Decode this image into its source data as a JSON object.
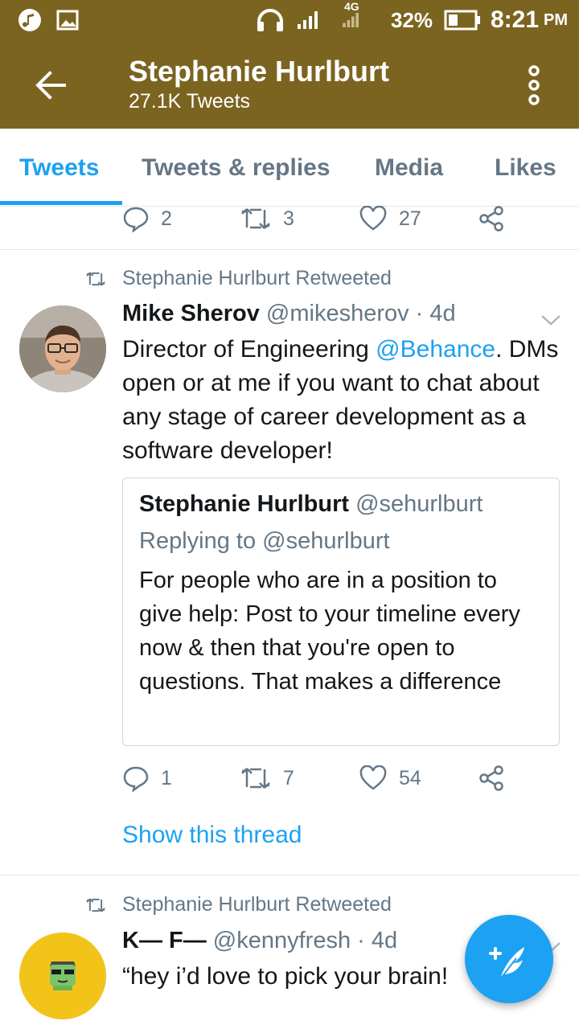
{
  "status_bar": {
    "icons": [
      "music-note-icon",
      "image-icon",
      "headphones-icon",
      "signal-icon",
      "4g-signal-icon",
      "battery-icon"
    ],
    "network": "4G",
    "battery": "32%",
    "time": "8:21",
    "ampm": "PM"
  },
  "header": {
    "title": "Stephanie Hurlburt",
    "subtitle": "27.1K Tweets"
  },
  "tabs": [
    {
      "label": "Tweets",
      "active": true
    },
    {
      "label": "Tweets & replies",
      "active": false
    },
    {
      "label": "Media",
      "active": false
    },
    {
      "label": "Likes",
      "active": false
    }
  ],
  "top_actions": {
    "replies": "2",
    "retweets": "3",
    "likes": "27"
  },
  "tweet1": {
    "retweeted_by": "Stephanie Hurlburt Retweeted",
    "name": "Mike Sherov",
    "handle": "@mikesherov · 4d",
    "text_before": "Director of Engineering ",
    "mention": "@Behance",
    "text_after": ". DMs open or at me if you want to chat about any stage of career development as a software developer!",
    "quote": {
      "name": "Stephanie Hurlburt",
      "handle": "@sehurlburt",
      "replying_to": "Replying to @sehurlburt",
      "text": "For people who are in a position to give help: Post to your timeline every now & then that you're open to questions. That makes a difference"
    },
    "actions": {
      "replies": "1",
      "retweets": "7",
      "likes": "54"
    },
    "show_thread": "Show this thread"
  },
  "tweet2": {
    "retweeted_by": "Stephanie Hurlburt Retweeted",
    "name": "K— F—",
    "handle": "@kennyfresh · 4d",
    "text": "“hey i’d love to pick your brain!"
  },
  "colors": {
    "header_bg": "#7b6420",
    "accent": "#1da1f2",
    "muted": "#657786"
  }
}
